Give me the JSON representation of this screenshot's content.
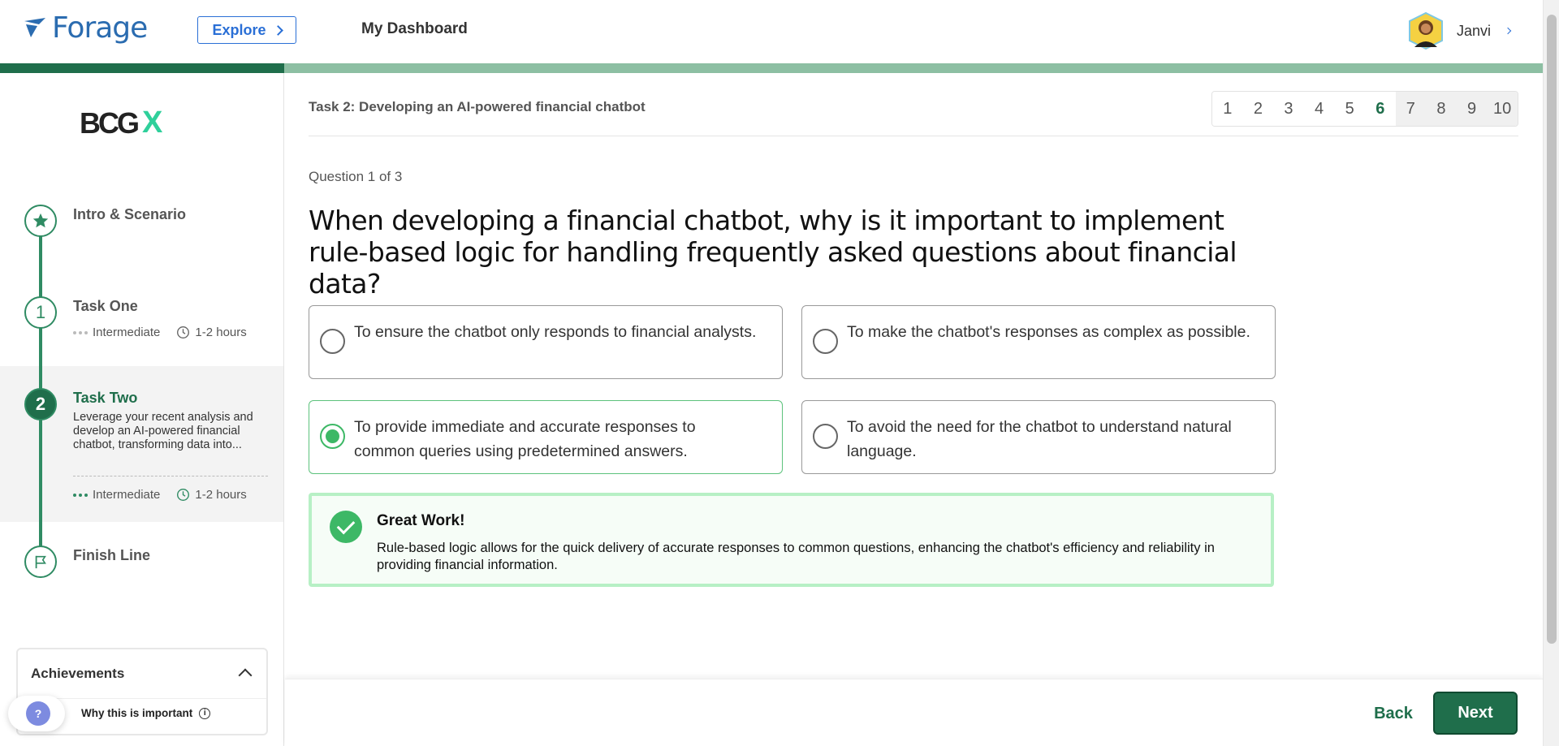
{
  "header": {
    "logo_text": "Forage",
    "explore_label": "Explore",
    "dashboard_label": "My Dashboard",
    "user_name": "Janvi"
  },
  "progress": {
    "completed_fraction": 0.184
  },
  "sidebar": {
    "brand_text": "BCG",
    "brand_x": "X",
    "steps": [
      {
        "number": "",
        "title": "Intro & Scenario"
      },
      {
        "number": "1",
        "title": "Task One",
        "level": "Intermediate",
        "duration": "1-2 hours"
      },
      {
        "number": "2",
        "title": "Task Two",
        "description": "Leverage your recent analysis and develop an AI-powered financial chatbot, transforming data into...",
        "level": "Intermediate",
        "duration": "1-2 hours"
      },
      {
        "number": "",
        "title": "Finish Line"
      }
    ],
    "achievements_label": "Achievements",
    "help_symbol": "?",
    "why_label": "Why this is important",
    "info_symbol": "i"
  },
  "main": {
    "task_title": "Task 2: Developing an AI-powered financial chatbot",
    "pages": [
      "1",
      "2",
      "3",
      "4",
      "5",
      "6",
      "7",
      "8",
      "9",
      "10"
    ],
    "current_page": "6",
    "question_count": "Question 1 of 3",
    "question": "When developing a financial chatbot, why is it important to implement rule-based logic for handling frequently asked questions about financial data?",
    "options": [
      "To ensure the chatbot only responds to financial analysts.",
      "To make the chatbot's responses as complex as possible.",
      "To provide immediate and accurate responses to common queries using predetermined answers.",
      "To avoid the need for the chatbot to understand natural language."
    ],
    "selected_option": 2,
    "feedback": {
      "title": "Great Work!",
      "text": "Rule-based logic allows for the quick delivery of accurate responses to common questions, enhancing the chatbot's efficiency and reliability in providing financial information."
    }
  },
  "footer": {
    "back_label": "Back",
    "next_label": "Next"
  },
  "colors": {
    "primary_green": "#1f6e4b",
    "success_green": "#3db866",
    "link_blue": "#2a6fd6"
  }
}
